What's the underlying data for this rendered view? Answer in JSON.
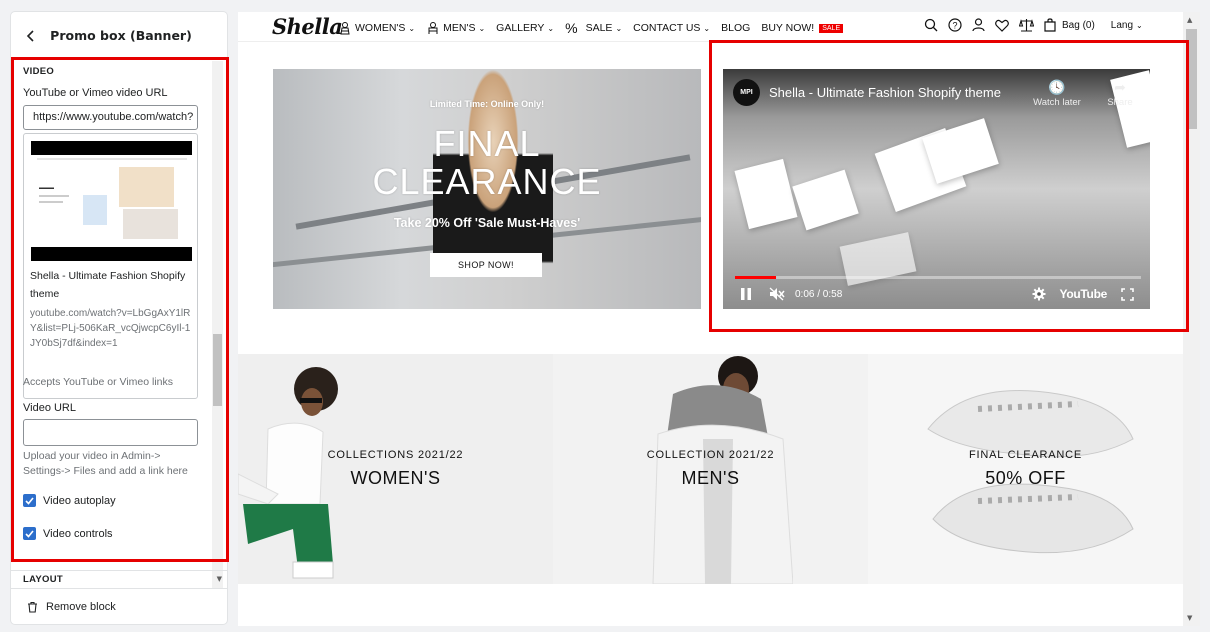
{
  "panel": {
    "title": "Promo box (Banner)",
    "section_video": "VIDEO",
    "youtube_label": "YouTube or Vimeo video URL",
    "youtube_value": "https://www.youtube.com/watch?",
    "preview_title": "Shella - Ultimate Fashion Shopify theme",
    "preview_url": "youtube.com/watch?v=LbGgAxY1lRY&list=PLj-506KaR_vcQjwcpC6yIl-1JY0bSj7df&index=1",
    "accepts_help": "Accepts YouTube or Vimeo links",
    "video_url_label": "Video URL",
    "video_url_value": "",
    "upload_help": "Upload your video in Admin-> Settings-> Files and add a link here",
    "autoplay_label": "Video autoplay",
    "autoplay_checked": true,
    "controls_label": "Video controls",
    "controls_checked": true,
    "section_layout": "LAYOUT",
    "remove_label": "Remove block"
  },
  "store": {
    "logo": "Shella",
    "nav": [
      {
        "label": "WOMEN'S",
        "dropdown": true
      },
      {
        "label": "MEN'S",
        "dropdown": true
      },
      {
        "label": "GALLERY",
        "dropdown": true
      },
      {
        "label": "SALE",
        "dropdown": true
      },
      {
        "label": "CONTACT US",
        "dropdown": true
      },
      {
        "label": "BLOG",
        "dropdown": false
      },
      {
        "label": "BUY NOW!",
        "dropdown": false,
        "badge": "SALE"
      }
    ],
    "bag_label": "Bag (0)",
    "lang_label": "Lang",
    "promo": {
      "eyebrow": "Limited Time: Online Only!",
      "headline_line1": "FINAL",
      "headline_line2": "CLEARANCE",
      "subline": "Take 20% Off 'Sale Must-Haves'",
      "button": "SHOP NOW!"
    },
    "video": {
      "channel": "MPI",
      "title": "Shella - Ultimate Fashion Shopify theme",
      "watch_later": "Watch later",
      "share": "Share",
      "time": "0:06 / 0:58",
      "progress": 0.1,
      "brand": "YouTube"
    },
    "tiles": [
      {
        "cap1": "COLLECTIONS 2021/22",
        "cap2": "WOMEN'S"
      },
      {
        "cap1": "COLLECTION 2021/22",
        "cap2": "MEN'S"
      },
      {
        "cap1": "FINAL CLEARANCE",
        "cap2": "50% OFF"
      }
    ]
  },
  "colors": {
    "highlight": "#e60000",
    "checkbox": "#2c6ecb",
    "sale_badge": "#e00000",
    "yt_progress": "#ff0000"
  }
}
